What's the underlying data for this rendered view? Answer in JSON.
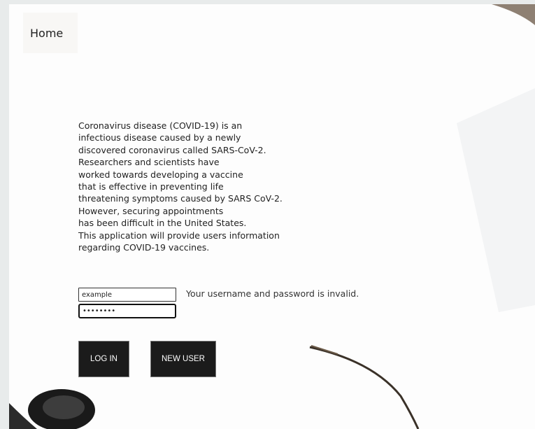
{
  "nav": {
    "home_label": "Home"
  },
  "intro_lines": [
    "Coronavirus disease (COVID-19) is an",
    "infectious disease caused by a newly",
    "discovered coronavirus called SARS-CoV-2.",
    "Researchers and scientists have",
    "worked towards developing a vaccine",
    "that is effective in preventing life",
    "threatening symptoms caused by SARS CoV-2.",
    "However, securing appointments",
    "has been difficult in the United States.",
    "This application will provide users information",
    "regarding COVID-19 vaccines."
  ],
  "login": {
    "username_value": "example",
    "password_value": "••••••••",
    "error_message": "Your username and password is invalid.",
    "login_label": "LOG IN",
    "new_user_label": "NEW USER"
  },
  "colors": {
    "button_bg": "#1b1b1b",
    "page_bg": "#fdfdfd",
    "frame_bg": "#e8ebeb"
  }
}
